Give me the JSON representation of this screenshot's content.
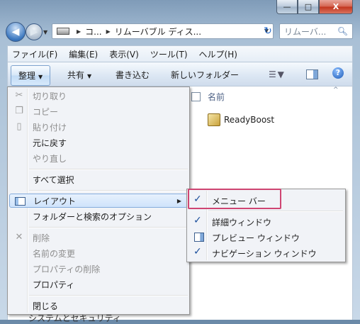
{
  "window": {
    "caption": {
      "minimize": "—",
      "maximize": "□",
      "close": "X"
    }
  },
  "nav": {
    "back_glyph": "◀",
    "forward_glyph": "▶",
    "address_segments": [
      "コ...",
      "リムーバブル ディス..."
    ],
    "search_placeholder": "リムーバ...",
    "refresh_glyph": "↻"
  },
  "menubar": {
    "items": [
      "ファイル(F)",
      "編集(E)",
      "表示(V)",
      "ツール(T)",
      "ヘルプ(H)"
    ]
  },
  "cmdbar": {
    "organize": "整理",
    "share": "共有",
    "burn": "書き込む",
    "new_folder": "新しいフォルダー",
    "help": "?"
  },
  "content": {
    "column_name": "名前",
    "items": [
      {
        "name": "ReadyBoost"
      }
    ],
    "bottom_peek": "システムとセキュリティ"
  },
  "context_menu": {
    "items": [
      {
        "label": "切り取り",
        "enabled": false,
        "icon": "scissors-icon"
      },
      {
        "label": "コピー",
        "enabled": false,
        "icon": "copy-icon"
      },
      {
        "label": "貼り付け",
        "enabled": false,
        "icon": "paste-icon"
      },
      {
        "label": "元に戻す",
        "enabled": true
      },
      {
        "label": "やり直し",
        "enabled": false
      },
      {
        "label": "すべて選択",
        "enabled": true
      },
      {
        "label": "レイアウト",
        "enabled": true,
        "icon": "layout-icon",
        "submenu": true,
        "highlighted": true
      },
      {
        "label": "フォルダーと検索のオプション",
        "enabled": true
      },
      {
        "label": "削除",
        "enabled": false,
        "icon": "delete-icon"
      },
      {
        "label": "名前の変更",
        "enabled": false
      },
      {
        "label": "プロパティの削除",
        "enabled": false
      },
      {
        "label": "プロパティ",
        "enabled": true
      },
      {
        "label": "閉じる",
        "enabled": true
      }
    ]
  },
  "layout_submenu": {
    "items": [
      {
        "label": "メニュー バー",
        "checked": true
      },
      {
        "label": "詳細ウィンドウ",
        "checked": true
      },
      {
        "label": "プレビュー ウィンドウ",
        "checked": false
      },
      {
        "label": "ナビゲーション ウィンドウ",
        "checked": true
      }
    ]
  },
  "colors": {
    "accent": "#1b4f9c",
    "highlight_box": "#cf4572"
  }
}
